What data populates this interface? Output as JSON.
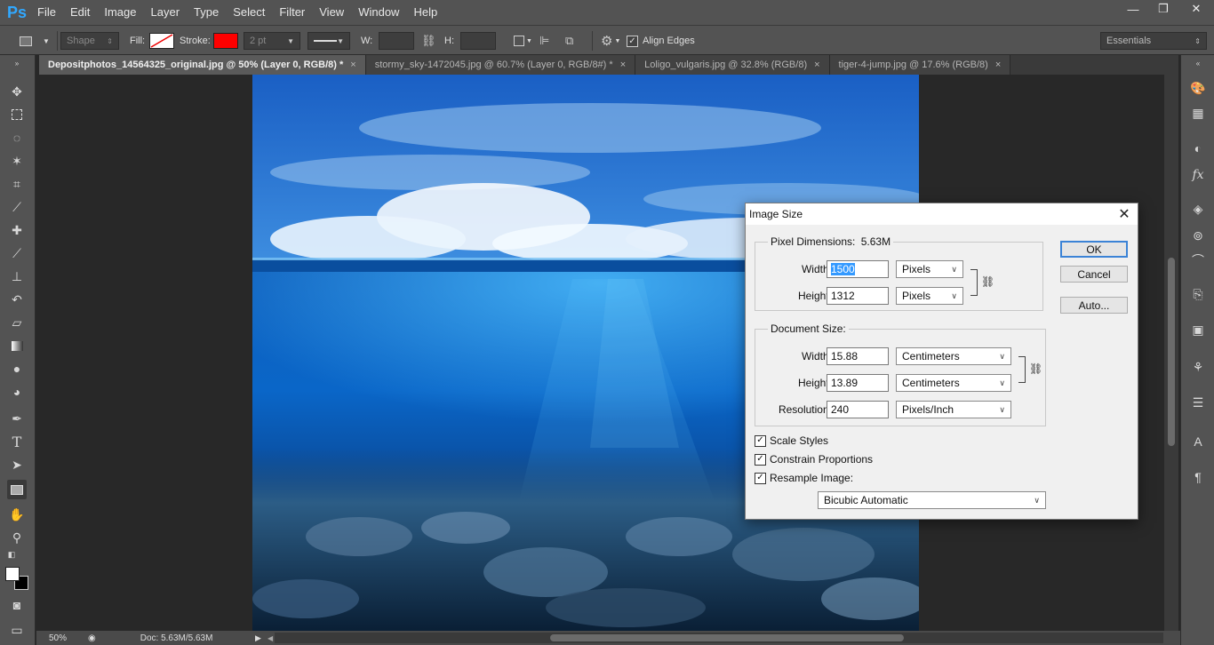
{
  "menubar": {
    "logo": "Ps",
    "items": [
      "File",
      "Edit",
      "Image",
      "Layer",
      "Type",
      "Select",
      "Filter",
      "View",
      "Window",
      "Help"
    ],
    "window_controls": [
      "—",
      "❐",
      "✕"
    ]
  },
  "options": {
    "mode": "Shape",
    "fill_label": "Fill:",
    "stroke_label": "Stroke:",
    "stroke_color": "#ff0000",
    "stroke_width": "2 pt",
    "w_label": "W:",
    "h_label": "H:",
    "align_edges": "Align Edges",
    "workspace": "Essentials"
  },
  "tabs": [
    {
      "label": "Depositphotos_14564325_original.jpg @ 50% (Layer 0, RGB/8) *",
      "close": "×"
    },
    {
      "label": "stormy_sky-1472045.jpg @ 60.7% (Layer 0, RGB/8#) *",
      "close": "×"
    },
    {
      "label": "Loligo_vulgaris.jpg @ 32.8% (RGB/8)",
      "close": "×"
    },
    {
      "label": "tiger-4-jump.jpg @ 17.6% (RGB/8)",
      "close": "×"
    }
  ],
  "status": {
    "zoom": "50%",
    "doc": "Doc: 5.63M/5.63M"
  },
  "dialog": {
    "title": "Image Size",
    "close": "✕",
    "pixel_dimensions_label": "Pixel Dimensions:",
    "pixel_dimensions_value": "5.63M",
    "pixel_width_label": "Width:",
    "pixel_width": "1500",
    "pixel_width_unit": "Pixels",
    "pixel_height_label": "Height:",
    "pixel_height": "1312",
    "pixel_height_unit": "Pixels",
    "document_size_label": "Document Size:",
    "doc_width_label": "Width:",
    "doc_width": "15.88",
    "doc_width_unit": "Centimeters",
    "doc_height_label": "Height:",
    "doc_height": "13.89",
    "doc_height_unit": "Centimeters",
    "resolution_label": "Resolution:",
    "resolution": "240",
    "resolution_unit": "Pixels/Inch",
    "scale_styles": "Scale Styles",
    "constrain_proportions": "Constrain Proportions",
    "resample_image": "Resample Image:",
    "resample_method": "Bicubic Automatic",
    "ok": "OK",
    "cancel": "Cancel",
    "auto": "Auto..."
  }
}
